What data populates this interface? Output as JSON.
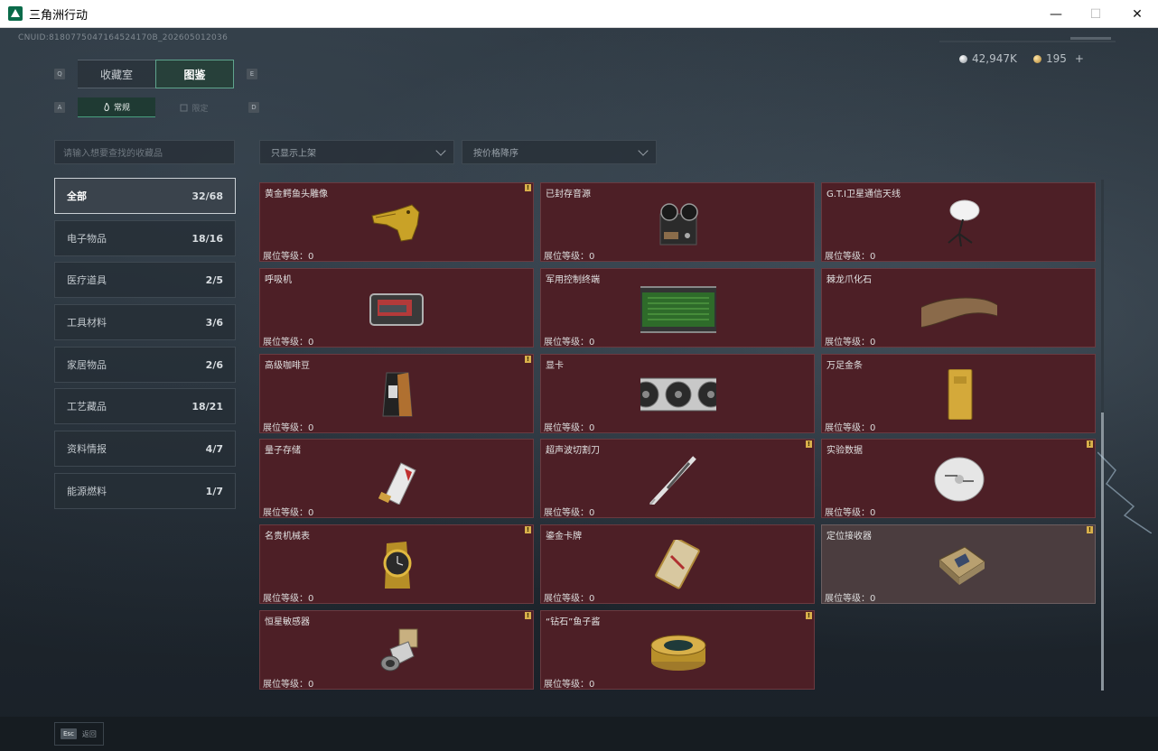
{
  "window": {
    "title": "三角洲行动",
    "minimize": "—",
    "maximize": "☐",
    "close": "✕"
  },
  "header": {
    "uid": "CNUID:8180775047164524170B_202605012036",
    "currency_silver": "42,947K",
    "currency_gold": "195",
    "add_label": "+"
  },
  "tabs": {
    "collection": "收藏室",
    "catalog": "图鉴",
    "key_q": "Q",
    "key_e": "E"
  },
  "subtabs": {
    "normal": "常规",
    "limited": "限定",
    "key_a": "A",
    "key_d": "D"
  },
  "search": {
    "placeholder": "请输入想要查找的收藏品"
  },
  "filters": {
    "shelf_filter": "只显示上架",
    "sort": "按价格降序"
  },
  "categories": [
    {
      "label": "全部",
      "count": "32/68"
    },
    {
      "label": "电子物品",
      "count": "18/16"
    },
    {
      "label": "医疗道具",
      "count": "2/5"
    },
    {
      "label": "工具材料",
      "count": "3/6"
    },
    {
      "label": "家居物品",
      "count": "2/6"
    },
    {
      "label": "工艺藏品",
      "count": "18/21"
    },
    {
      "label": "资料情报",
      "count": "4/7"
    },
    {
      "label": "能源燃料",
      "count": "1/7"
    }
  ],
  "level_label": "展位等级：0",
  "flag_mark": "!",
  "items": [
    {
      "name": "黄金鳄鱼头雕像",
      "icon": "gold-crocodile-head-icon",
      "flag": true
    },
    {
      "name": "已封存音源",
      "icon": "reel-tape-recorder-icon",
      "flag": false
    },
    {
      "name": "G.T.I卫星通信天线",
      "icon": "satellite-dish-icon",
      "flag": false
    },
    {
      "name": "呼吸机",
      "icon": "ventilator-icon",
      "flag": false
    },
    {
      "name": "军用控制终端",
      "icon": "military-terminal-icon",
      "flag": false
    },
    {
      "name": "棘龙爪化石",
      "icon": "claw-fossil-icon",
      "flag": false
    },
    {
      "name": "高级咖啡豆",
      "icon": "coffee-bag-icon",
      "flag": true
    },
    {
      "name": "显卡",
      "icon": "graphics-card-icon",
      "flag": false
    },
    {
      "name": "万足金条",
      "icon": "gold-bar-icon",
      "flag": false
    },
    {
      "name": "量子存储",
      "icon": "quantum-storage-icon",
      "flag": false
    },
    {
      "name": "超声波切割刀",
      "icon": "ultrasonic-knife-icon",
      "flag": true
    },
    {
      "name": "实验数据",
      "icon": "data-disc-icon",
      "flag": true
    },
    {
      "name": "名贵机械表",
      "icon": "luxury-watch-icon",
      "flag": true
    },
    {
      "name": "鎏金卡牌",
      "icon": "gilded-card-icon",
      "flag": false
    },
    {
      "name": "定位接收器",
      "icon": "locator-receiver-icon",
      "flag": true
    },
    {
      "name": "恒星敏感器",
      "icon": "star-sensor-icon",
      "flag": true
    },
    {
      "name": "“钻石”鱼子酱",
      "icon": "caviar-tin-icon",
      "flag": true
    }
  ],
  "footer": {
    "esc_key": "Esc",
    "back_label": "返回"
  },
  "colors": {
    "card_bg": "#4d1f26",
    "accent_green": "#5fa48d",
    "flag_yellow": "#d8b04b"
  }
}
